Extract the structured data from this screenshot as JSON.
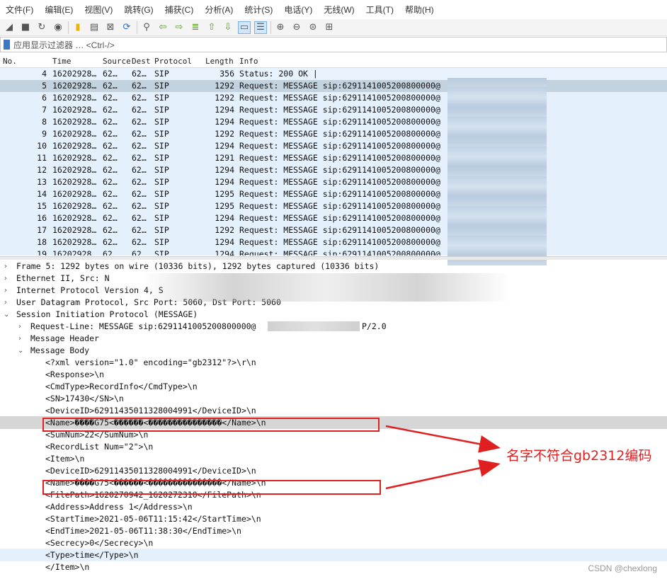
{
  "menu": [
    "文件(F)",
    "编辑(E)",
    "视图(V)",
    "跳转(G)",
    "捕获(C)",
    "分析(A)",
    "统计(S)",
    "电话(Y)",
    "无线(W)",
    "工具(T)",
    "帮助(H)"
  ],
  "filter": {
    "label": "应用显示过滤器 … <Ctrl-/>"
  },
  "columns": {
    "no": "No.",
    "time": "Time",
    "source": "Source",
    "dest": "Dest",
    "protocol": "Protocol",
    "length": "Length",
    "info": "Info"
  },
  "packets": [
    {
      "no": "4",
      "time": "16202928…",
      "src": "62…",
      "dst": "62…",
      "proto": "SIP",
      "len": "356",
      "info": "Status: 200 OK |"
    },
    {
      "no": "5",
      "time": "16202928…",
      "src": "62…",
      "dst": "62…",
      "proto": "SIP",
      "len": "1292",
      "info": "Request: MESSAGE sip:6291141005200800000@"
    },
    {
      "no": "6",
      "time": "16202928…",
      "src": "62…",
      "dst": "62…",
      "proto": "SIP",
      "len": "1292",
      "info": "Request: MESSAGE sip:6291141005200800000@"
    },
    {
      "no": "7",
      "time": "16202928…",
      "src": "62…",
      "dst": "62…",
      "proto": "SIP",
      "len": "1294",
      "info": "Request: MESSAGE sip:6291141005200800000@"
    },
    {
      "no": "8",
      "time": "16202928…",
      "src": "62…",
      "dst": "62…",
      "proto": "SIP",
      "len": "1294",
      "info": "Request: MESSAGE sip:6291141005200800000@"
    },
    {
      "no": "9",
      "time": "16202928…",
      "src": "62…",
      "dst": "62…",
      "proto": "SIP",
      "len": "1292",
      "info": "Request: MESSAGE sip:6291141005200800000@"
    },
    {
      "no": "10",
      "time": "16202928…",
      "src": "62…",
      "dst": "62…",
      "proto": "SIP",
      "len": "1294",
      "info": "Request: MESSAGE sip:6291141005200800000@"
    },
    {
      "no": "11",
      "time": "16202928…",
      "src": "62…",
      "dst": "62…",
      "proto": "SIP",
      "len": "1291",
      "info": "Request: MESSAGE sip:6291141005200800000@"
    },
    {
      "no": "12",
      "time": "16202928…",
      "src": "62…",
      "dst": "62…",
      "proto": "SIP",
      "len": "1294",
      "info": "Request: MESSAGE sip:6291141005200800000@"
    },
    {
      "no": "13",
      "time": "16202928…",
      "src": "62…",
      "dst": "62…",
      "proto": "SIP",
      "len": "1294",
      "info": "Request: MESSAGE sip:6291141005200800000@"
    },
    {
      "no": "14",
      "time": "16202928…",
      "src": "62…",
      "dst": "62…",
      "proto": "SIP",
      "len": "1295",
      "info": "Request: MESSAGE sip:6291141005200800000@"
    },
    {
      "no": "15",
      "time": "16202928…",
      "src": "62…",
      "dst": "62…",
      "proto": "SIP",
      "len": "1295",
      "info": "Request: MESSAGE sip:6291141005200800000@"
    },
    {
      "no": "16",
      "time": "16202928…",
      "src": "62…",
      "dst": "62…",
      "proto": "SIP",
      "len": "1294",
      "info": "Request: MESSAGE sip:6291141005200800000@"
    },
    {
      "no": "17",
      "time": "16202928…",
      "src": "62…",
      "dst": "62…",
      "proto": "SIP",
      "len": "1292",
      "info": "Request: MESSAGE sip:6291141005200800000@"
    },
    {
      "no": "18",
      "time": "16202928…",
      "src": "62…",
      "dst": "62…",
      "proto": "SIP",
      "len": "1294",
      "info": "Request: MESSAGE sip:6291141005200800000@"
    },
    {
      "no": "19",
      "time": "16202928…",
      "src": "62…",
      "dst": "62…",
      "proto": "SIP",
      "len": "1294",
      "info": "Request: MESSAGE sip:6291141005200800000@"
    }
  ],
  "selected_packet_no": "5",
  "details": {
    "frame": "Frame 5: 1292 bytes on wire (10336 bits), 1292 bytes captured (10336 bits)",
    "ethernet": "Ethernet II, Src: N",
    "ip": "Internet Protocol Version 4, S",
    "udp": "User Datagram Protocol, Src Port: 5060, Dst Port: 5060",
    "sip": "Session Initiation Protocol (MESSAGE)",
    "request_line": "Request-Line: MESSAGE sip:6291141005200800000@",
    "request_line_tail": "P/2.0",
    "message_header": "Message Header",
    "message_body": "Message Body"
  },
  "body_lines": [
    "<?xml version=\"1.0\" encoding=\"gb2312\"?>\\r\\n",
    "<Response>\\n",
    "<CmdType>RecordInfo</CmdType>\\n",
    "<SN>17430</SN>\\n",
    "<DeviceID>62911435011328004991</DeviceID>\\n",
    "<Name>����G75<������<���������������</Name>\\n",
    "<SumNum>22</SumNum>\\n",
    "<RecordList Num=\"2\">\\n",
    "<Item>\\n",
    "<DeviceID>62911435011328004991</DeviceID>\\n",
    "<Name>����G75<������<���������������</Name>\\n",
    "<FilePath>1620270942_1620272310</FilePath>\\n",
    "<Address>Address 1</Address>\\n",
    "<StartTime>2021-05-06T11:15:42</StartTime>\\n",
    "<EndTime>2021-05-06T11:38:30</EndTime>\\n",
    "<Secrecy>0</Secrecy>\\n",
    "<Type>time</Type>\\n",
    "</Item>\\n"
  ],
  "annotation": "名字不符合gb2312编码",
  "watermark": "CSDN @chexlong",
  "colors": {
    "annotation": "#e02020",
    "row_bg": "#e4f0fc",
    "selected_row": "#c3d2df"
  },
  "toolbar_icons": [
    "shark-fin-icon",
    "stop-icon",
    "restart-icon",
    "options-icon",
    "open-file-icon",
    "save-file-icon",
    "close-file-icon",
    "reload-icon",
    "find-icon",
    "back-icon",
    "forward-icon",
    "goto-icon",
    "first-icon",
    "last-icon",
    "autoscroll-icon",
    "colorize-icon",
    "zoom-in-icon",
    "zoom-out-icon",
    "zoom-reset-icon",
    "resize-columns-icon"
  ]
}
